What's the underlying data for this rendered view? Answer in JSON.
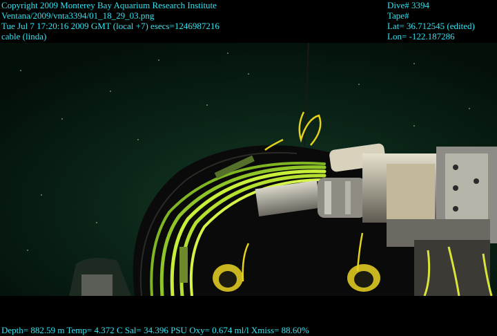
{
  "header_left": {
    "line1": "Copyright 2009 Monterey Bay Aquarium Research Institute",
    "line2": "Ventana/2009/vnta3394/01_18_29_03.png",
    "line3": "Tue Jul  7 17:20:16 2009 GMT (local +7)  esecs=1246987216",
    "line4": "cable (linda)"
  },
  "header_right": {
    "line1": "Dive# 3394",
    "line2": "Tape#",
    "line3": "Lat= 36.712545 (edited)",
    "line4": "Lon= -122.187286"
  },
  "footer": {
    "line1": "Depth= 882.59 m  Temp= 4.372 C  Sal= 34.396 PSU  Oxy= 0.674 ml/l  Xmiss= 88.60%"
  },
  "colors": {
    "overlay_text": "#34e3f0",
    "water": "#061a10",
    "cable": "#c8f03a"
  }
}
